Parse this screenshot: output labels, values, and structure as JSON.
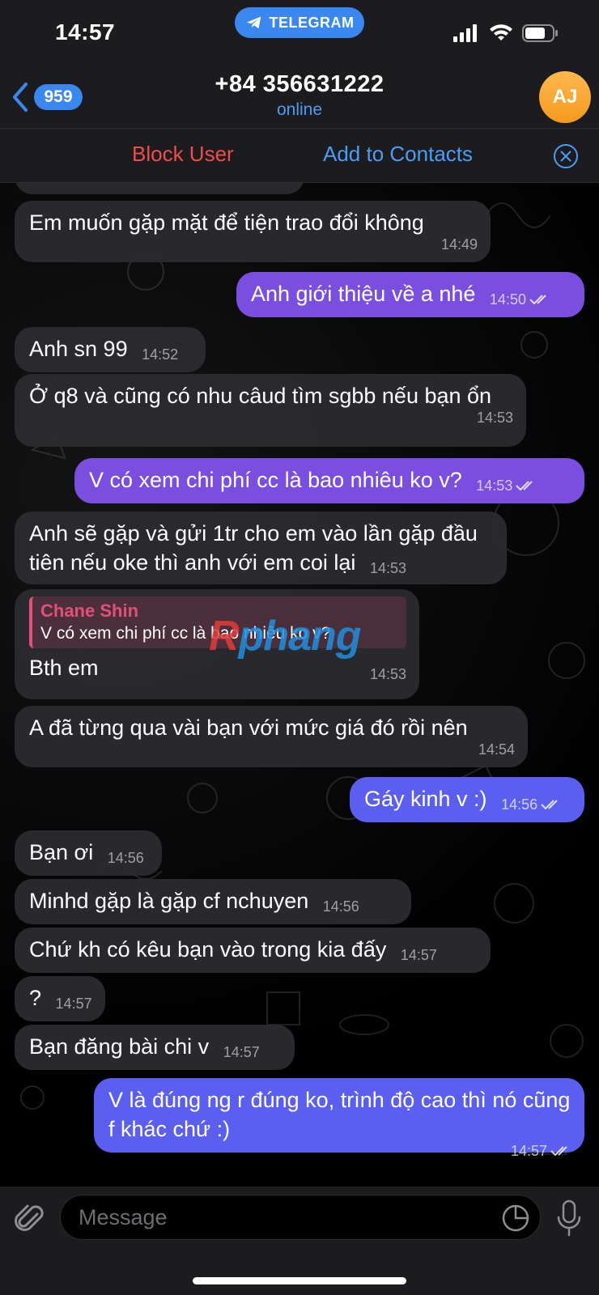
{
  "status_bar": {
    "time": "14:57",
    "app_label": "TELEGRAM"
  },
  "header": {
    "back_count": "959",
    "title": "+84 356631222",
    "subtitle": "online",
    "avatar_initials": "AJ"
  },
  "action_bar": {
    "block_label": "Block User",
    "add_label": "Add to Contacts"
  },
  "messages": [
    {
      "dir": "in",
      "text": "Em muốn gặp mặt để tiện trao đổi không",
      "time": "14:49"
    },
    {
      "dir": "out",
      "text": "Anh giới thiệu về a nhé",
      "time": "14:50"
    },
    {
      "dir": "in",
      "text": "Anh sn 99",
      "time": "14:52"
    },
    {
      "dir": "in",
      "text": "Ở q8 và cũng có nhu câud tìm sgbb nếu bạn ổn",
      "time": "14:53"
    },
    {
      "dir": "out",
      "text": "V có xem chi phí cc là bao nhiêu ko v?",
      "time": "14:53"
    },
    {
      "dir": "in",
      "text": "Anh sẽ gặp và gửi 1tr cho em vào lần gặp đầu tiên nếu oke thì anh với em coi lại",
      "time": "14:53"
    },
    {
      "dir": "in",
      "reply_name": "Chane Shin",
      "reply_text": "V có xem chi phí cc là bao nhiêu ko v?",
      "text": "Bth em",
      "time": "14:53"
    },
    {
      "dir": "in",
      "text": "A đã từng qua vài bạn với mức giá đó rồi nên",
      "time": "14:54"
    },
    {
      "dir": "out",
      "text": "Gáy kinh v :)",
      "time": "14:56"
    },
    {
      "dir": "in",
      "text": "Bạn ơi",
      "time": "14:56"
    },
    {
      "dir": "in",
      "text": "Minhd gặp là gặp cf nchuyen",
      "time": "14:56"
    },
    {
      "dir": "in",
      "text": "Chứ kh có kêu bạn vào trong kia đấy",
      "time": "14:57"
    },
    {
      "dir": "in",
      "text": "?",
      "time": "14:57"
    },
    {
      "dir": "in",
      "text": "Bạn đăng bài chi v",
      "time": "14:57"
    },
    {
      "dir": "out",
      "text": "V là đúng ng r đúng ko, trình độ cao thì nó cũng f khác chứ :)",
      "time": "14:57"
    }
  ],
  "watermark": {
    "first": "R",
    "rest": "phang"
  },
  "input": {
    "placeholder": "Message"
  },
  "colors": {
    "accent": "#3a87f0",
    "outgoing": "#7a4fe0",
    "incoming": "#2c2c30",
    "danger": "#ef4d4d",
    "avatar": "#f49a1e"
  },
  "icons": [
    "telegram-icon",
    "signal-icon",
    "wifi-icon",
    "battery-icon",
    "chevron-left-icon",
    "close-circle-icon",
    "double-check-icon",
    "paperclip-icon",
    "sticker-icon",
    "microphone-icon"
  ]
}
